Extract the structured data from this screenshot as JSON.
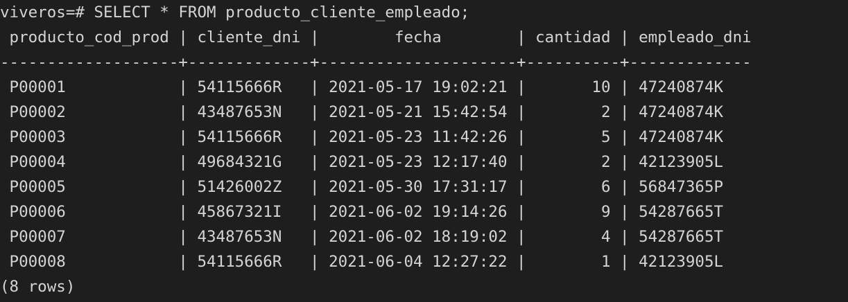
{
  "terminal": {
    "prompt": "viveros=# ",
    "command": "SELECT * FROM producto_cliente_empleado;",
    "header_line": " producto_cod_prod | cliente_dni |        fecha        | cantidad | empleado_dni",
    "separator_line": "-------------------+-------------+---------------------+----------+-------------",
    "columns": [
      "producto_cod_prod",
      "cliente_dni",
      "fecha",
      "cantidad",
      "empleado_dni"
    ],
    "rows": [
      {
        "line": " P00001            | 54115666R   | 2021-05-17 19:02:21 |       10 | 47240874K"
      },
      {
        "line": " P00002            | 43487653N   | 2021-05-21 15:42:54 |        2 | 47240874K"
      },
      {
        "line": " P00003            | 54115666R   | 2021-05-23 11:42:26 |        5 | 47240874K"
      },
      {
        "line": " P00004            | 49684321G   | 2021-05-23 12:17:40 |        2 | 42123905L"
      },
      {
        "line": " P00005            | 51426002Z   | 2021-05-30 17:31:17 |        6 | 56847365P"
      },
      {
        "line": " P00006            | 45867321I   | 2021-06-02 19:14:26 |        9 | 54287665T"
      },
      {
        "line": " P00007            | 43487653N   | 2021-06-02 18:19:02 |        4 | 54287665T"
      },
      {
        "line": " P00008            | 54115666R   | 2021-06-04 12:27:22 |        1 | 42123905L"
      }
    ],
    "footer": "(8 rows)"
  }
}
